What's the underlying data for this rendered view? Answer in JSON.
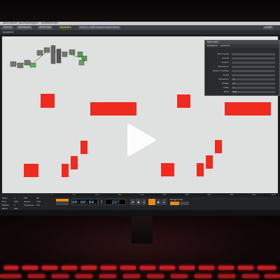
{
  "app": {
    "titlebar": "Derivative TouchDesigner - Untitled.toe",
    "toolbar": {
      "items": [
        "TOOLS",
        "NETWORK",
        "PERFORM",
        "Realtime",
        "1920 x 1080  Experimental Build",
        "COMP"
      ]
    },
    "path": "/project1"
  },
  "parameters": {
    "header": "Null   null1",
    "tabs": [
      "Transform",
      "Common"
    ],
    "rows": [
      {
        "label": "Pivot Level",
        "value": ""
      },
      {
        "label": "Pos Fit",
        "value": ""
      },
      {
        "label": "Output",
        "value": ""
      },
      {
        "label": "Resolution",
        "value": ""
      },
      {
        "label": "Extend Overlap",
        "value": ""
      },
      {
        "label": "Invert",
        "value": ""
      },
      {
        "label": "Transform",
        "value": "0"
      },
      {
        "label": "Rotate",
        "value": "0"
      },
      {
        "label": "Scale",
        "value": "1"
      },
      {
        "label": "Pivot",
        "value": "0.5"
      }
    ]
  },
  "timeline": {
    "timecode": "00:00:04.57",
    "frame": "297",
    "ruler_ticks": [
      "1",
      "60",
      "120",
      "180",
      "240",
      "300",
      "360",
      "420",
      "480",
      "540",
      "600"
    ],
    "range_label": "Range Limit",
    "info": [
      "Start",
      "End",
      "RStart",
      "REnd",
      "FPS",
      "Tempo",
      "Signature"
    ],
    "info_values": [
      "1",
      "600",
      "1",
      "600",
      "60",
      "120",
      "4/4"
    ]
  },
  "colors": {
    "shape_red": "#ef2a1f",
    "canvas": "#dfe0e0",
    "keyboard_glow": "#c81d20",
    "timecode": "#7fd3ff"
  },
  "overlay": {
    "icon": "play-icon"
  }
}
